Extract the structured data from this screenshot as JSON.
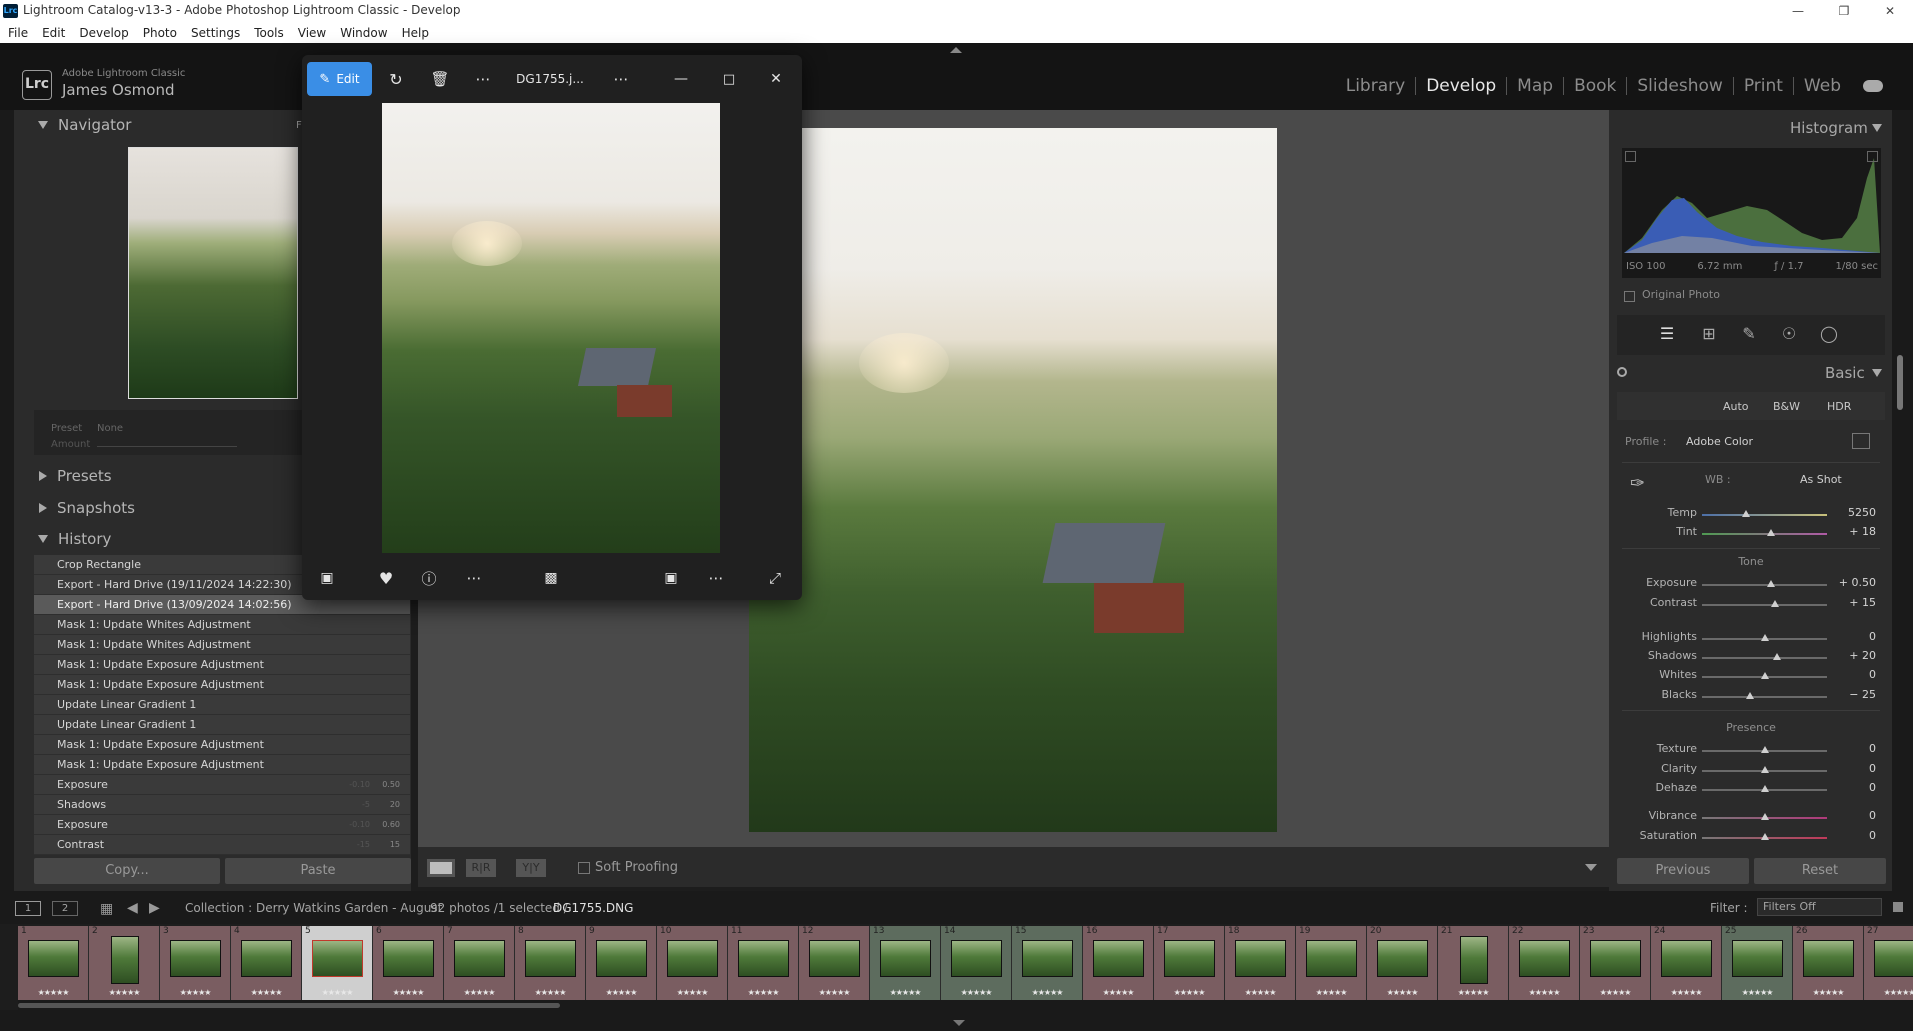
{
  "window": {
    "title": "Lightroom Catalog-v13-3 - Adobe Photoshop Lightroom Classic - Develop"
  },
  "menu": [
    "File",
    "Edit",
    "Develop",
    "Photo",
    "Settings",
    "Tools",
    "View",
    "Window",
    "Help"
  ],
  "identity": {
    "logo": "Lrc",
    "product": "Adobe Lightroom Classic",
    "user": "James Osmond"
  },
  "modules": {
    "library": "Library",
    "develop": "Develop",
    "map": "Map",
    "book": "Book",
    "slideshow": "Slideshow",
    "print": "Print",
    "web": "Web",
    "active": "Develop"
  },
  "left_panel": {
    "navigator": "Navigator",
    "navigator_mode": "F",
    "preset_label": "Preset",
    "preset_value": "None",
    "amount_label": "Amount",
    "presets": "Presets",
    "snapshots": "Snapshots",
    "history": "History",
    "history_items": [
      {
        "label": "Crop Rectangle",
        "v1": "",
        "v2": ""
      },
      {
        "label": "Export - Hard Drive (19/11/2024 14:22:30)",
        "v1": "",
        "v2": ""
      },
      {
        "label": "Export - Hard Drive (13/09/2024 14:02:56)",
        "v1": "",
        "v2": ""
      },
      {
        "label": "Mask 1: Update Whites Adjustment",
        "v1": "",
        "v2": ""
      },
      {
        "label": "Mask 1: Update Whites Adjustment",
        "v1": "",
        "v2": ""
      },
      {
        "label": "Mask 1: Update Exposure Adjustment",
        "v1": "",
        "v2": ""
      },
      {
        "label": "Mask 1: Update Exposure Adjustment",
        "v1": "",
        "v2": ""
      },
      {
        "label": "Update Linear Gradient 1",
        "v1": "",
        "v2": ""
      },
      {
        "label": "Update Linear Gradient 1",
        "v1": "",
        "v2": ""
      },
      {
        "label": "Mask 1: Update Exposure Adjustment",
        "v1": "",
        "v2": ""
      },
      {
        "label": "Mask 1: Update Exposure Adjustment",
        "v1": "",
        "v2": ""
      },
      {
        "label": "Exposure",
        "v1": "-0.10",
        "v2": "0.50"
      },
      {
        "label": "Shadows",
        "v1": "-5",
        "v2": "20"
      },
      {
        "label": "Exposure",
        "v1": "-0.10",
        "v2": "0.60"
      },
      {
        "label": "Contrast",
        "v1": "-15",
        "v2": "15"
      }
    ],
    "selected_history_index": 2,
    "copy_button": "Copy...",
    "paste_button": "Paste"
  },
  "toolbar": {
    "soft_proofing": "Soft Proofing"
  },
  "right_panel": {
    "histogram": "Histogram",
    "iso": "ISO 100",
    "focal": "6.72 mm",
    "aperture": "ƒ / 1.7",
    "shutter": "1/80 sec",
    "original_photo": "Original Photo",
    "basic": "Basic",
    "auto": "Auto",
    "bw": "B&W",
    "hdr": "HDR",
    "profile_label": "Profile :",
    "profile_value": "Adobe Color",
    "wb_label": "WB :",
    "wb_value": "As Shot",
    "tone_label": "Tone",
    "presence_label": "Presence",
    "sliders": [
      {
        "label": "Temp",
        "value": "5250",
        "pos": 0.35,
        "group": "wb"
      },
      {
        "label": "Tint",
        "value": "+ 18",
        "pos": 0.55,
        "group": "wb"
      },
      {
        "label": "Exposure",
        "value": "+ 0.50",
        "pos": 0.55,
        "group": "tone"
      },
      {
        "label": "Contrast",
        "value": "+ 15",
        "pos": 0.58,
        "group": "tone"
      },
      {
        "label": "Highlights",
        "value": "0",
        "pos": 0.5,
        "group": "tone2"
      },
      {
        "label": "Shadows",
        "value": "+ 20",
        "pos": 0.6,
        "group": "tone2"
      },
      {
        "label": "Whites",
        "value": "0",
        "pos": 0.5,
        "group": "tone2"
      },
      {
        "label": "Blacks",
        "value": "− 25",
        "pos": 0.38,
        "group": "tone2"
      },
      {
        "label": "Texture",
        "value": "0",
        "pos": 0.5,
        "group": "presence"
      },
      {
        "label": "Clarity",
        "value": "0",
        "pos": 0.5,
        "group": "presence"
      },
      {
        "label": "Dehaze",
        "value": "0",
        "pos": 0.5,
        "group": "presence"
      },
      {
        "label": "Vibrance",
        "value": "0",
        "pos": 0.5,
        "group": "presence2"
      },
      {
        "label": "Saturation",
        "value": "0",
        "pos": 0.5,
        "group": "presence2"
      }
    ],
    "previous_button": "Previous",
    "reset_button": "Reset"
  },
  "filmstrip_bar": {
    "view1": "1",
    "view2": "2",
    "collection": "Collection : Derry Watkins Garden - August",
    "count": "92 photos /1 selected /",
    "filename": "DG1755.DNG",
    "filter_label": "Filter :",
    "filter_value": "Filters Off"
  },
  "filmstrip": [
    {
      "n": "1",
      "c": "pink"
    },
    {
      "n": "2",
      "c": "pink",
      "port": true
    },
    {
      "n": "3",
      "c": "pink"
    },
    {
      "n": "4",
      "c": "pink"
    },
    {
      "n": "5",
      "c": "sel"
    },
    {
      "n": "6",
      "c": "pink"
    },
    {
      "n": "7",
      "c": "pink"
    },
    {
      "n": "8",
      "c": "pink"
    },
    {
      "n": "9",
      "c": "pink"
    },
    {
      "n": "10",
      "c": "pink"
    },
    {
      "n": "11",
      "c": "pink"
    },
    {
      "n": "12",
      "c": "pink"
    },
    {
      "n": "13",
      "c": "green"
    },
    {
      "n": "14",
      "c": "green"
    },
    {
      "n": "15",
      "c": "green"
    },
    {
      "n": "16",
      "c": "pink"
    },
    {
      "n": "17",
      "c": "pink"
    },
    {
      "n": "18",
      "c": "pink"
    },
    {
      "n": "19",
      "c": "pink"
    },
    {
      "n": "20",
      "c": "pink"
    },
    {
      "n": "21",
      "c": "pink",
      "port": true
    },
    {
      "n": "22",
      "c": "pink"
    },
    {
      "n": "23",
      "c": "pink"
    },
    {
      "n": "24",
      "c": "pink"
    },
    {
      "n": "25",
      "c": "green"
    },
    {
      "n": "26",
      "c": "pink"
    },
    {
      "n": "27",
      "c": "pink"
    }
  ],
  "stars": "★★★★★",
  "viewer": {
    "edit_label": "Edit",
    "filename": "DG1755.j..."
  },
  "colors": {
    "accent": "#3a8ee6",
    "panel": "#2b2b2b",
    "filmstrip_pink": "#7a5d61",
    "filmstrip_green": "#5d6c5e"
  }
}
